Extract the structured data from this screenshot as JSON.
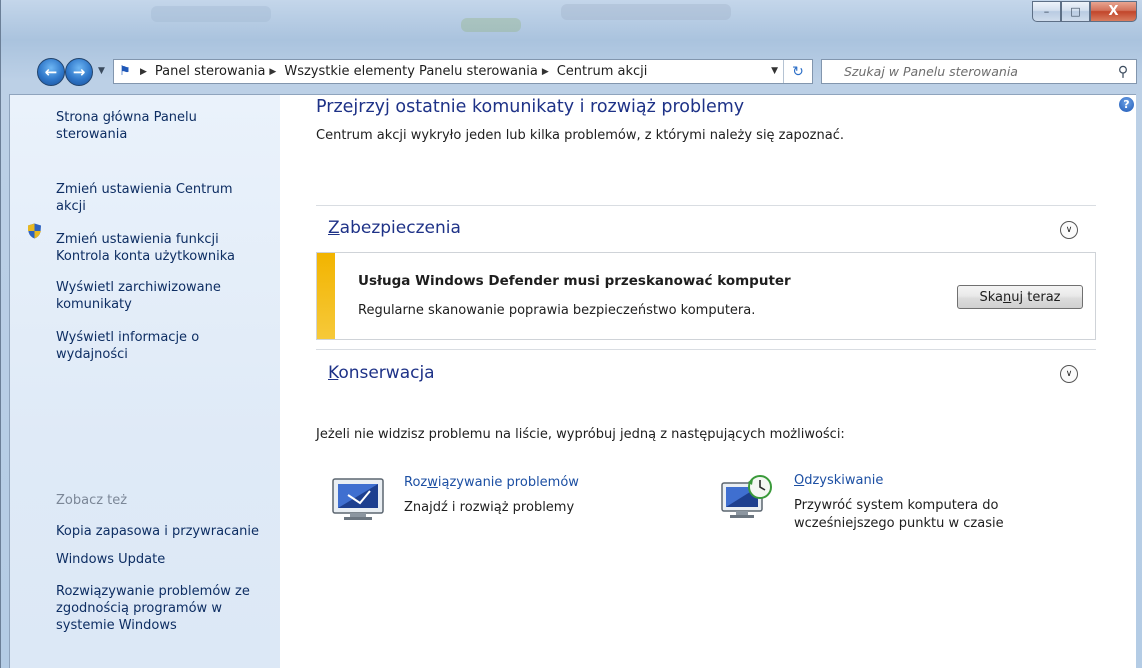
{
  "window": {
    "buttons": {
      "minimize": "–",
      "maximize": "□",
      "close": "X"
    }
  },
  "nav": {
    "back_icon": "back-arrow-icon",
    "forward_icon": "forward-arrow-icon",
    "breadcrumbs": [
      "Panel sterowania",
      "Wszystkie elementy Panelu sterowania",
      "Centrum akcji"
    ],
    "search_placeholder": "Szukaj w Panelu sterowania"
  },
  "sidebar": {
    "items": [
      "Strona główna Panelu sterowania",
      "Zmień ustawienia Centrum akcji",
      "Zmień ustawienia funkcji Kontrola konta użytkownika",
      "Wyświetl zarchiwizowane komunikaty",
      "Wyświetl informacje o wydajności"
    ],
    "see_also_label": "Zobacz też",
    "see_also": [
      "Kopia zapasowa i przywracanie",
      "Windows Update",
      "Rozwiązywanie problemów ze zgodnością programów w systemie Windows"
    ]
  },
  "main": {
    "title": "Przejrzyj ostatnie komunikaty i rozwiąż problemy",
    "subtitle": "Centrum akcji wykryło jeden lub kilka problemów, z którymi należy się zapoznać.",
    "sections": {
      "security": {
        "accel": "Z",
        "rest": "abezpieczenia"
      },
      "maintenance": {
        "accel": "K",
        "rest": "onserwacja"
      }
    },
    "alert": {
      "heading": "Usługa Windows Defender musi przeskanować komputer",
      "text": "Regularne skanowanie poprawia bezpieczeństwo komputera.",
      "button": {
        "pre": "Ska",
        "accel": "n",
        "post": "uj teraz"
      },
      "color": "#f2b400"
    },
    "hint": "Jeżeli nie widzisz problemu na liście, wypróbuj jedną z następujących możliwości:",
    "tools": [
      {
        "link_pre": "Roz",
        "link_accel": "w",
        "link_post": "iązywanie problemów",
        "desc": [
          "Znajdź i rozwiąż problemy"
        ],
        "icon": "troubleshooting-icon"
      },
      {
        "link_pre": "",
        "link_accel": "O",
        "link_post": "dzyskiwanie",
        "desc": [
          "Przywróć system komputera do",
          "wcześniejszego punktu w czasie"
        ],
        "icon": "recovery-icon"
      }
    ]
  },
  "colors": {
    "link": "#1e3287",
    "sidebar_bg": "#e3edf9",
    "accent": "#1c4fa3"
  }
}
